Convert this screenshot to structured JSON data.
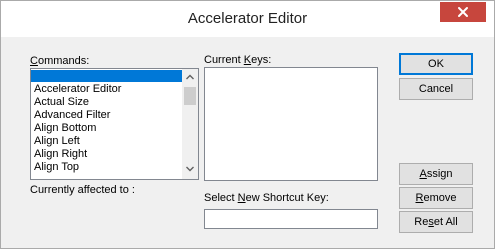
{
  "dialog": {
    "title": "Accelerator Editor"
  },
  "labels": {
    "commands_prefix": "C",
    "commands_rest": "ommands:",
    "current_keys_pre": "Current ",
    "current_keys_u": "K",
    "current_keys_post": "eys:",
    "currently_affected": "Currently affected to :",
    "select_pre": "Select ",
    "select_u": "N",
    "select_post": "ew Shortcut Key:"
  },
  "commands": {
    "items": [
      "",
      "Accelerator Editor",
      "Actual Size",
      "Advanced Filter",
      "Align Bottom",
      "Align Left",
      "Align Right",
      "Align Top"
    ],
    "selected_index": 0
  },
  "shortcut_input": {
    "value": ""
  },
  "buttons": {
    "ok": "OK",
    "cancel": "Cancel",
    "assign_u": "A",
    "assign_rest": "ssign",
    "remove_u": "R",
    "remove_rest": "emove",
    "reset_pre": "Re",
    "reset_u": "s",
    "reset_post": "et All"
  },
  "icons": {
    "close": "close-icon",
    "scroll_up": "chevron-up-icon",
    "scroll_down": "chevron-down-icon"
  },
  "colors": {
    "close_button": "#c7463d",
    "selection": "#0078d7",
    "default_button_border": "#0078d7"
  }
}
